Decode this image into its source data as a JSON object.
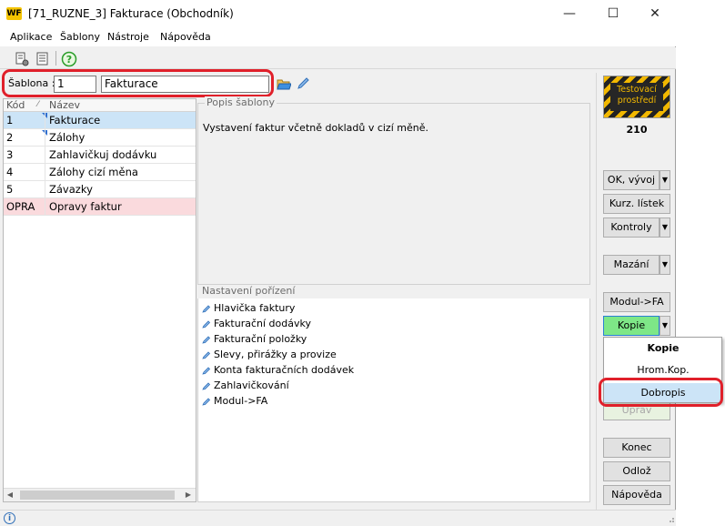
{
  "window": {
    "title": "[71_RUZNE_3] Fakturace (Obchodník)",
    "logo_text": "WF"
  },
  "window_controls": {
    "minimize": "—",
    "maximize": "☐",
    "close": "✕"
  },
  "menu": [
    "Aplikace",
    "Šablony",
    "Nástroje",
    "Nápověda"
  ],
  "toolbar": {
    "help_glyph": "?"
  },
  "template": {
    "label": "Šablona :",
    "number": "1",
    "name": "Fakturace"
  },
  "grid": {
    "headers": {
      "code": "Kód",
      "name": "Název"
    },
    "rows": [
      {
        "code": "1",
        "name": "Fakturace",
        "selected": true
      },
      {
        "code": "2",
        "name": "Zálohy"
      },
      {
        "code": "3",
        "name": "Zahlavičkuj dodávku"
      },
      {
        "code": "4",
        "name": "Zálohy cizí měna"
      },
      {
        "code": "5",
        "name": "Závazky"
      },
      {
        "code": "OPRA",
        "name": "Opravy faktur",
        "highlight": true
      }
    ]
  },
  "description": {
    "label": "Popis šablony",
    "text": "Vystavení faktur včetně dokladů v cizí měně."
  },
  "settings": {
    "label": "Nastavení pořízení",
    "items": [
      "Hlavička faktury",
      "Fakturační dodávky",
      "Fakturační položky",
      "Slevy, přirážky a provize",
      "Konta fakturačních dodávek",
      "Zahlavičkování",
      "Modul->FA"
    ]
  },
  "env_badge": {
    "text": "Testovací prostředí",
    "number": "210"
  },
  "buttons": {
    "ok": "OK, vývoj",
    "rate": "Kurz. lístek",
    "checks": "Kontroly",
    "delete": "Mazání",
    "module": "Modul->FA",
    "copy": "Kopie",
    "edit": "Uprav",
    "end": "Konec",
    "postpone": "Odlož",
    "help": "Nápověda"
  },
  "copy_menu": [
    "Kopie",
    "Hrom.Kop.",
    "Dobropis"
  ],
  "status": {
    "info_glyph": "i"
  },
  "colors": {
    "selected_row": "#cce4f7",
    "highlight_row": "#fadadd",
    "copy_button": "#7ee787",
    "annotation": "#e0202a"
  }
}
